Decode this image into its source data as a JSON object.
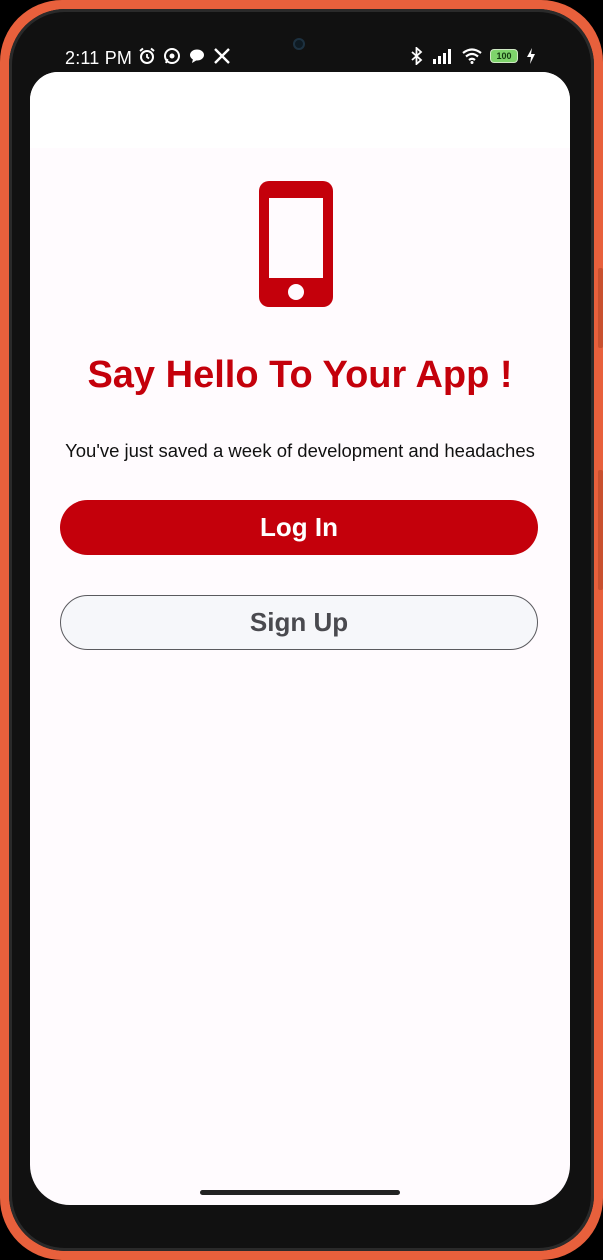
{
  "status_bar": {
    "time": "2:11 PM",
    "battery_level": "100",
    "left_icons": [
      "alarm-icon",
      "whatsapp-icon",
      "chat-bubble-icon",
      "x-icon"
    ],
    "right_icons": [
      "bluetooth-icon",
      "signal-icon",
      "wifi-icon",
      "battery-icon",
      "charging-icon"
    ]
  },
  "hero": {
    "icon": "smartphone-icon",
    "icon_color": "#c4000b"
  },
  "welcome": {
    "title": "Say Hello To Your App !",
    "subtitle": "You've just saved a week of development and headaches"
  },
  "actions": {
    "login_label": "Log In",
    "signup_label": "Sign Up"
  },
  "colors": {
    "accent": "#c4000b",
    "frame": "#e8603c",
    "background": "#fffbfe"
  }
}
